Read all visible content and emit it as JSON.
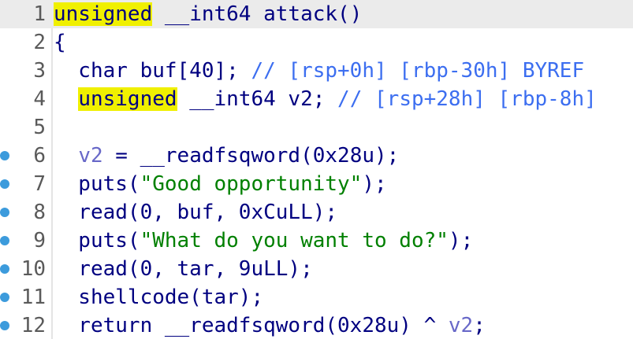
{
  "editor": {
    "lines": [
      {
        "num": "1",
        "breakpoint": false,
        "current": true,
        "tokens": [
          {
            "t": "unsigned",
            "c": "hl"
          },
          {
            "t": " __int64 attack()",
            "c": ""
          }
        ]
      },
      {
        "num": "2",
        "breakpoint": false,
        "current": false,
        "tokens": [
          {
            "t": "{",
            "c": ""
          }
        ]
      },
      {
        "num": "3",
        "breakpoint": false,
        "current": false,
        "tokens": [
          {
            "t": "  char buf[40]; ",
            "c": ""
          },
          {
            "t": "// [rsp+0h] [rbp-30h] BYREF",
            "c": "cm"
          }
        ]
      },
      {
        "num": "4",
        "breakpoint": false,
        "current": false,
        "tokens": [
          {
            "t": "  ",
            "c": ""
          },
          {
            "t": "unsigned",
            "c": "hl"
          },
          {
            "t": " __int64 v2; ",
            "c": ""
          },
          {
            "t": "// [rsp+28h] [rbp-8h]",
            "c": "cm"
          }
        ]
      },
      {
        "num": "5",
        "breakpoint": false,
        "current": false,
        "tokens": []
      },
      {
        "num": "6",
        "breakpoint": true,
        "current": false,
        "tokens": [
          {
            "t": "  ",
            "c": ""
          },
          {
            "t": "v2",
            "c": "vr"
          },
          {
            "t": " = __readfsqword(0x28u);",
            "c": ""
          }
        ]
      },
      {
        "num": "7",
        "breakpoint": true,
        "current": false,
        "tokens": [
          {
            "t": "  puts(",
            "c": ""
          },
          {
            "t": "\"Good opportunity\"",
            "c": "str"
          },
          {
            "t": ");",
            "c": ""
          }
        ]
      },
      {
        "num": "8",
        "breakpoint": true,
        "current": false,
        "tokens": [
          {
            "t": "  read(0, buf, 0xCuLL);",
            "c": ""
          }
        ]
      },
      {
        "num": "9",
        "breakpoint": true,
        "current": false,
        "tokens": [
          {
            "t": "  puts(",
            "c": ""
          },
          {
            "t": "\"What do you want to do?\"",
            "c": "str"
          },
          {
            "t": ");",
            "c": ""
          }
        ]
      },
      {
        "num": "10",
        "breakpoint": true,
        "current": false,
        "tokens": [
          {
            "t": "  read(0, tar, 9uLL);",
            "c": ""
          }
        ]
      },
      {
        "num": "11",
        "breakpoint": true,
        "current": false,
        "tokens": [
          {
            "t": "  shellcode(tar);",
            "c": ""
          }
        ]
      },
      {
        "num": "12",
        "breakpoint": true,
        "current": false,
        "tokens": [
          {
            "t": "  return __readfsqword(0x28u) ^ ",
            "c": ""
          },
          {
            "t": "v2",
            "c": "vr"
          },
          {
            "t": ";",
            "c": ""
          }
        ]
      }
    ]
  },
  "colors": {
    "keyword_highlight": "#f0f000",
    "code": "#000080",
    "comment": "#3c6ef0",
    "string": "#008000",
    "variable": "#6868c8",
    "breakpoint": "#3c9bdc",
    "current_line": "#ebebeb"
  },
  "icons": {
    "breakpoint": "breakpoint-dot-icon"
  }
}
